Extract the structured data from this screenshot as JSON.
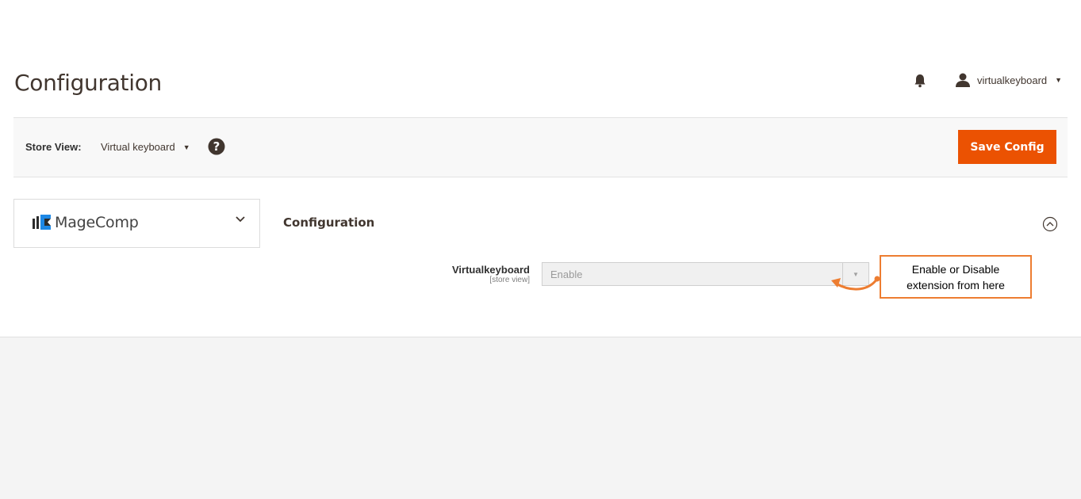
{
  "header": {
    "title": "Configuration",
    "username": "virtualkeyboard"
  },
  "store_bar": {
    "label": "Store View:",
    "selected_store": "Virtual keyboard",
    "save_label": "Save Config"
  },
  "sidebar": {
    "tab_label": "MageComp"
  },
  "section": {
    "title": "Configuration",
    "field": {
      "label": "Virtualkeyboard",
      "scope": "[store view]",
      "value": "Enable"
    }
  },
  "annotation": {
    "line1": "Enable or Disable",
    "line2": "extension from here"
  },
  "colors": {
    "accent": "#eb5202",
    "callout_border": "#ed7d31"
  },
  "icons": [
    "bell-icon",
    "user-icon",
    "help-icon",
    "chevron-down-icon",
    "collapse-icon"
  ]
}
